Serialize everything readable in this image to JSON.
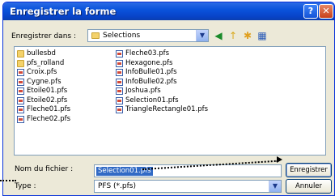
{
  "window": {
    "title": "Enregistrer la forme",
    "help_button": "?",
    "close_button": "✕"
  },
  "location": {
    "label": "Enregistrer dans :",
    "value": "Selections",
    "toolbar": [
      "back-icon",
      "up-folder-icon",
      "new-folder-icon",
      "view-menu-icon"
    ]
  },
  "files": {
    "column1": [
      {
        "name": "bullesbd",
        "type": "folder"
      },
      {
        "name": "pfs_rolland",
        "type": "folder"
      },
      {
        "name": "Croix.pfs",
        "type": "file"
      },
      {
        "name": "Cygne.pfs",
        "type": "file"
      },
      {
        "name": "Etoile01.pfs",
        "type": "file"
      },
      {
        "name": "Etoile02.pfs",
        "type": "file"
      },
      {
        "name": "Fleche01.pfs",
        "type": "file"
      },
      {
        "name": "Fleche02.pfs",
        "type": "file"
      }
    ],
    "column2": [
      {
        "name": "Fleche03.pfs",
        "type": "file"
      },
      {
        "name": "Hexagone.pfs",
        "type": "file"
      },
      {
        "name": "InfoBulle01.pfs",
        "type": "file"
      },
      {
        "name": "InfoBulle02.pfs",
        "type": "file"
      },
      {
        "name": "Joshua.pfs",
        "type": "file"
      },
      {
        "name": "Selection01.pfs",
        "type": "file"
      },
      {
        "name": "TriangleRectangle01.pfs",
        "type": "file"
      }
    ]
  },
  "filename": {
    "label": "Nom du fichier :",
    "value": "Selection01.pfs"
  },
  "filetype": {
    "label": "Type :",
    "value": "PFS (*.pfs)"
  },
  "buttons": {
    "save": "Enregistrer",
    "cancel": "Annuler"
  }
}
